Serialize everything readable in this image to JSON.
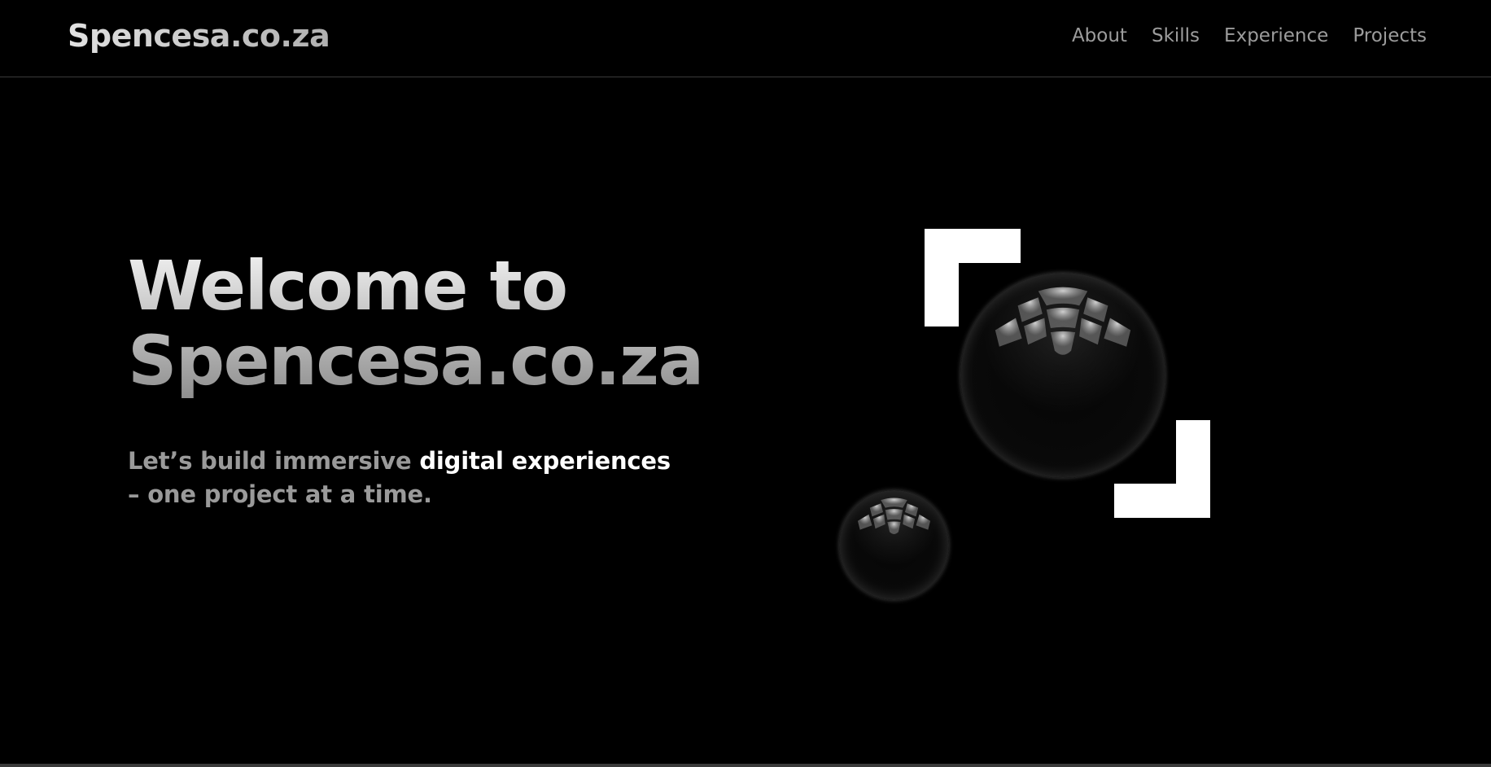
{
  "header": {
    "brand": "Spencesa.co.za",
    "nav": [
      {
        "label": "About"
      },
      {
        "label": "Skills"
      },
      {
        "label": "Experience"
      },
      {
        "label": "Projects"
      }
    ]
  },
  "hero": {
    "title_line1": "Welcome to",
    "title_line2": "Spencesa.co.za",
    "tagline_muted": "Let’s build immersive",
    "tagline_bright": "digital experiences",
    "tagline_line2": " – one project at a time."
  },
  "visual": {
    "icons": [
      "corner-bracket-top-left-icon",
      "corner-bracket-bottom-right-icon",
      "glass-sphere-large",
      "glass-sphere-small"
    ]
  },
  "colors": {
    "background": "#000000",
    "nav_text": "#9c9c9c",
    "tagline_muted": "#9a9a9a",
    "tagline_bright": "#ffffff",
    "header_border": "#3a3a3a",
    "bracket": "#ffffff"
  }
}
